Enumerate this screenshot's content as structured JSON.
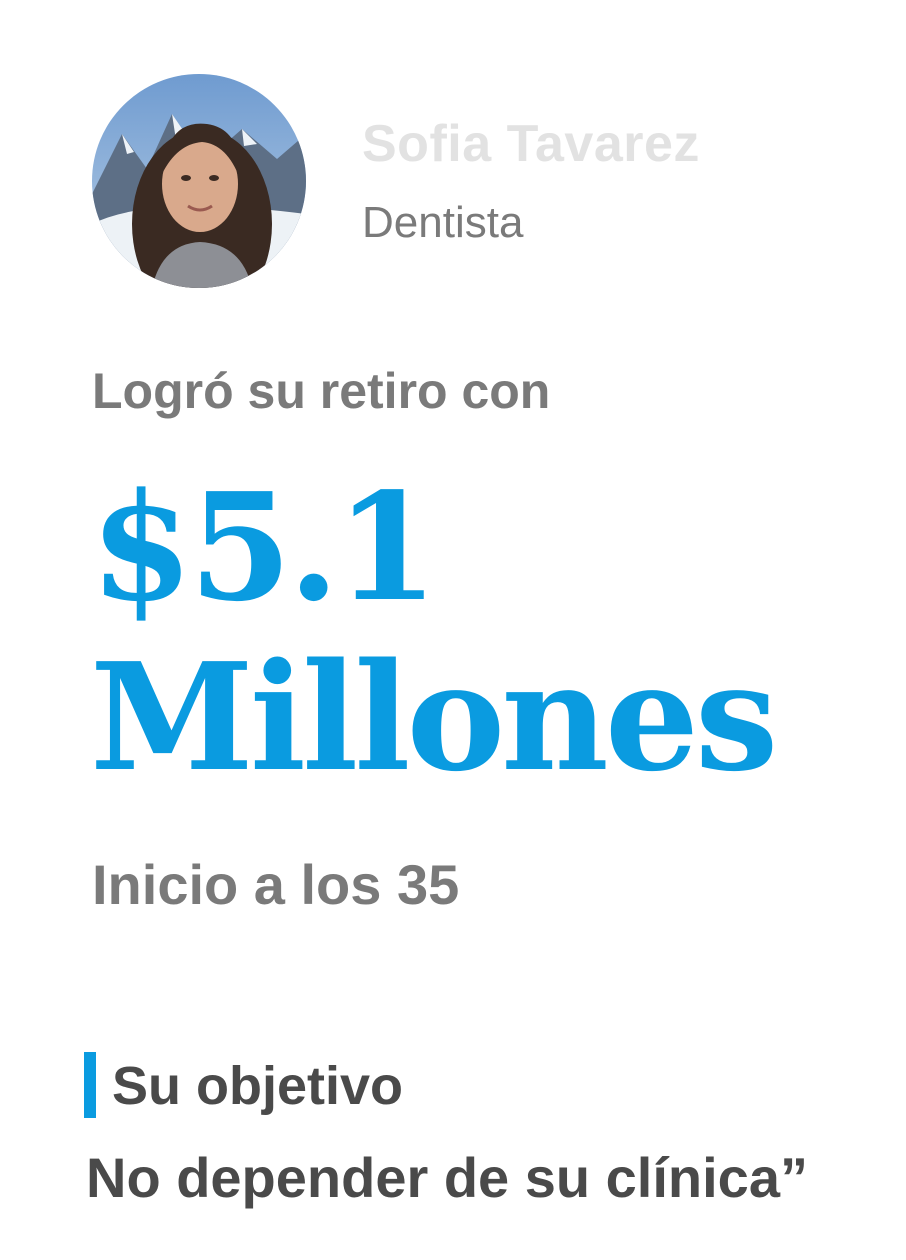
{
  "profile": {
    "name": "Sofia Tavarez",
    "role": "Dentista"
  },
  "headline": {
    "lead": "Logró su retiro con",
    "amount_line1": "$5.1",
    "amount_line2": "Millones",
    "start": "Inicio a los 35"
  },
  "goal": {
    "label": "Su objetivo",
    "text": "No depender de su clínica”"
  },
  "colors": {
    "accent": "#0a9be0",
    "muted_text": "#7a7a7a",
    "dark_text": "#4a4a4a",
    "name_text": "#e2e2e2"
  }
}
